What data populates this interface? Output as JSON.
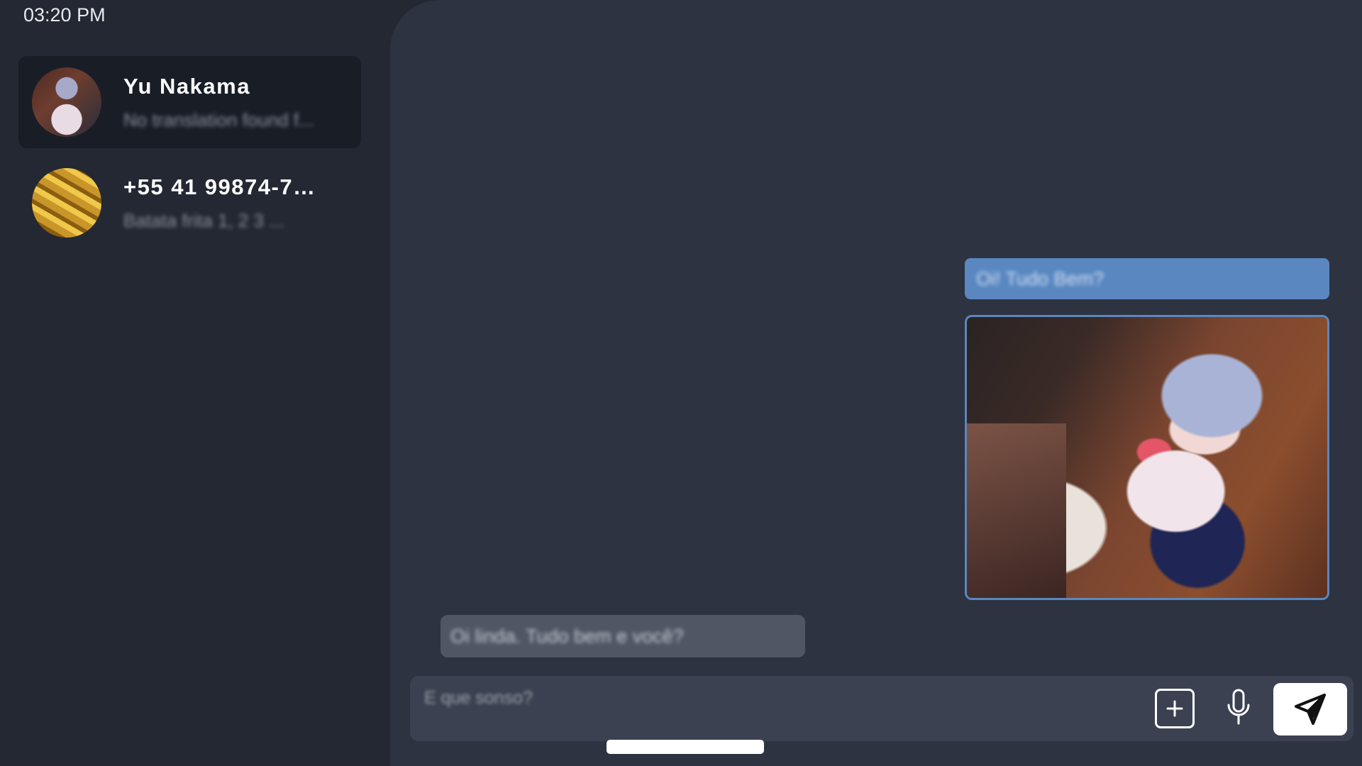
{
  "status_bar": {
    "time": "03:20 PM",
    "icons": [
      "signal-icon",
      "battery-icon"
    ],
    "battery_color": "#4ccf4c"
  },
  "contacts": [
    {
      "name": "Yu Nakama",
      "preview": "No translation found f...",
      "active": true,
      "avatar": "anime-character-avatar"
    },
    {
      "name": "+55 41 99874-7…",
      "preview": "Batata frita 1, 2 3 ...",
      "active": false,
      "avatar": "gold-bars-avatar"
    }
  ],
  "chat": {
    "messages": [
      {
        "direction": "sent",
        "type": "text",
        "text": "Oi! Tudo Bem?"
      },
      {
        "direction": "sent",
        "type": "image",
        "description": "anime-girl-kitchen-selfie"
      },
      {
        "direction": "received",
        "type": "text",
        "text": "Oi linda. Tudo bem e você?"
      }
    ],
    "accent_color": "#5a87c0"
  },
  "composer": {
    "placeholder": "E que sonso?",
    "buttons": [
      "add-attachment",
      "microphone",
      "send"
    ]
  }
}
